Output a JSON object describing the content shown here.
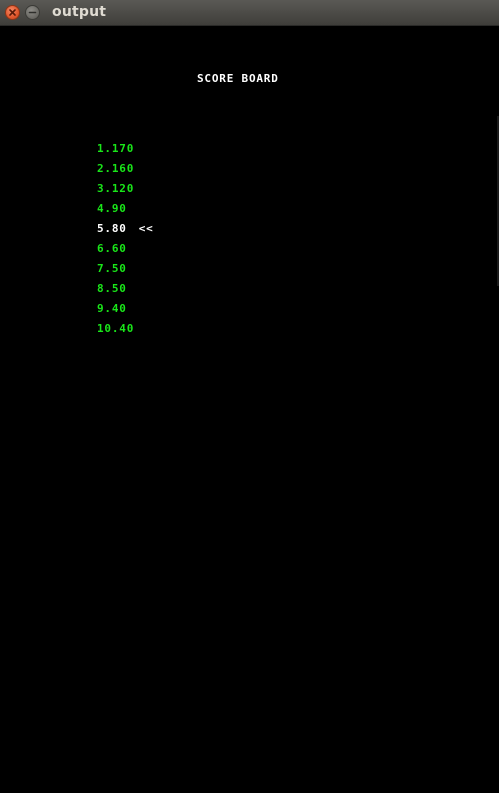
{
  "window": {
    "title": "output"
  },
  "scoreboard": {
    "heading": "SCORE BOARD",
    "current_marker": "<<",
    "rows": [
      {
        "text": "1.170"
      },
      {
        "text": "2.160"
      },
      {
        "text": "3.120"
      },
      {
        "text": "4.90"
      },
      {
        "text": "5.80"
      },
      {
        "text": "6.60"
      },
      {
        "text": "7.50"
      },
      {
        "text": "8.50"
      },
      {
        "text": "9.40"
      },
      {
        "text": "10.40"
      }
    ]
  },
  "colors": {
    "background": "#000000",
    "score_text": "#19e619",
    "highlight_text": "#ffffff",
    "title_bar": "#4a4945"
  }
}
